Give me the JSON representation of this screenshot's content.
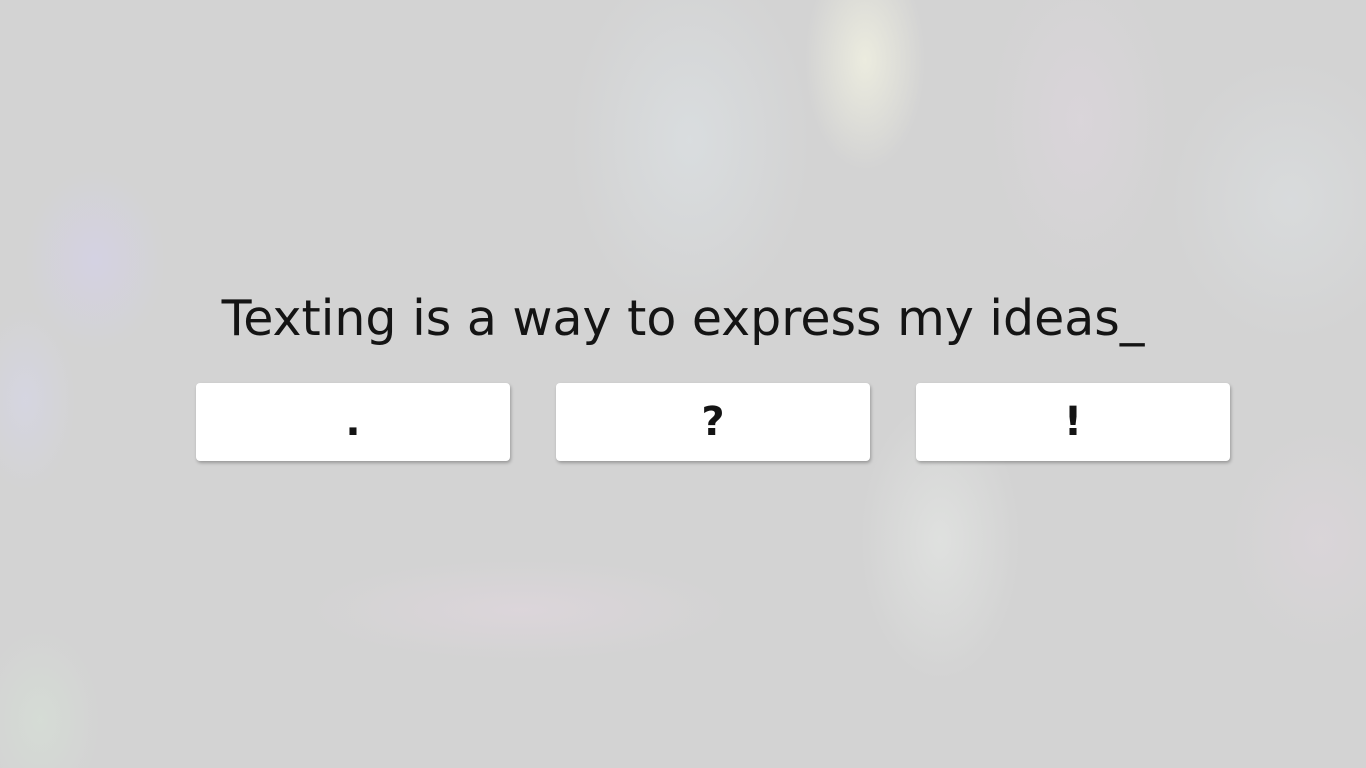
{
  "prompt": {
    "sentence": "Texting is a way to express my ideas_"
  },
  "choices": [
    {
      "label": "."
    },
    {
      "label": "?"
    },
    {
      "label": "!"
    }
  ]
}
